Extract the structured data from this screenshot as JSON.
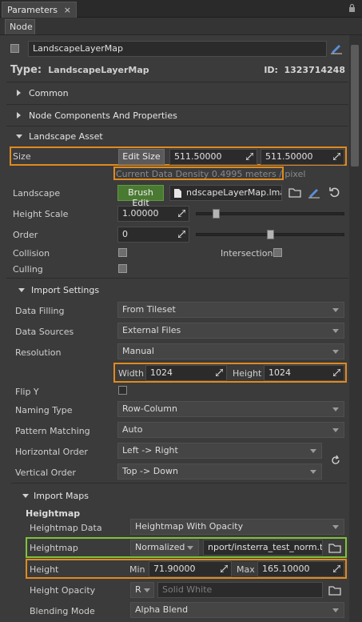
{
  "window": {
    "tab_title": "Parameters",
    "close_glyph": "×"
  },
  "subtab": {
    "label": "Node"
  },
  "node_name": "LandscapeLayerMap",
  "type_line": {
    "prefix": "Type:",
    "value": "LandscapeLayerMap",
    "id_prefix": "ID:",
    "id_value": "1323714248"
  },
  "sections": {
    "common": "Common",
    "node_components": "Node Components And Properties",
    "landscape_asset": "Landscape Asset",
    "import_settings": "Import Settings",
    "import_maps": "Import Maps"
  },
  "size": {
    "label": "Size",
    "button": "Edit Size",
    "x": "511.50000",
    "y": "511.50000"
  },
  "density_note": "Current Data Density 0.4995 meters / pixel",
  "landscape": {
    "label": "Landscape",
    "button": "Brush Edit",
    "file": "ndscapeLayerMap.lmap"
  },
  "height_scale": {
    "label": "Height Scale",
    "value": "1.00000",
    "slider_fraction": 0.12
  },
  "order": {
    "label": "Order",
    "value": "0",
    "slider_fraction": 0.5
  },
  "collision": {
    "label": "Collision",
    "checked": true
  },
  "intersection": {
    "label": "Intersection",
    "checked": true
  },
  "culling": {
    "label": "Culling",
    "checked": true
  },
  "import": {
    "data_filling": {
      "label": "Data Filling",
      "value": "From Tileset"
    },
    "data_sources": {
      "label": "Data Sources",
      "value": "External Files"
    },
    "resolution": {
      "label": "Resolution",
      "value": "Manual"
    },
    "width_label": "Width",
    "width_value": "1024",
    "height_label": "Height",
    "height_value": "1024",
    "flip_y": {
      "label": "Flip Y",
      "checked": false
    },
    "naming_type": {
      "label": "Naming Type",
      "value": "Row-Column"
    },
    "pattern_matching": {
      "label": "Pattern Matching",
      "value": "Auto"
    },
    "horizontal_order": {
      "label": "Horizontal Order",
      "value": "Left -> Right"
    },
    "vertical_order": {
      "label": "Vertical Order",
      "value": "Top -> Down"
    }
  },
  "maps": {
    "heightmap_title": "Heightmap",
    "heightmap_data": {
      "label": "Heightmap Data",
      "value": "Heightmap With Opacity"
    },
    "heightmap": {
      "label": "Heightmap",
      "mode": "Normalized",
      "file": "nport/insterra_test_norm.tif"
    },
    "height": {
      "label": "Height",
      "min_label": "Min",
      "min_value": "71.90000",
      "max_label": "Max",
      "max_value": "165.10000"
    },
    "height_opacity": {
      "label": "Height Opacity",
      "channel": "R",
      "placeholder": "Solid White"
    },
    "blending_mode": {
      "label": "Blending Mode",
      "value": "Alpha Blend"
    }
  },
  "colors": {
    "highlight_orange": "#e08a1e",
    "highlight_green": "#7fc23c",
    "brush_green": "#4a7a32"
  }
}
